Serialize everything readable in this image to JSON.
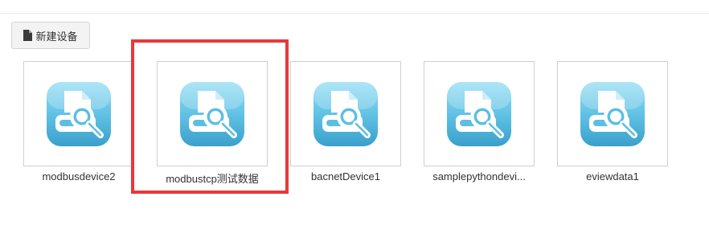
{
  "toolbar": {
    "new_device_label": "新建设备",
    "new_device_icon": "file-icon"
  },
  "devices": [
    {
      "name": "modbusdevice2",
      "icon": "device-search-icon"
    },
    {
      "name": "modbustcp测试数据",
      "icon": "device-search-icon"
    },
    {
      "name": "bacnetDevice1",
      "icon": "device-search-icon"
    },
    {
      "name": "samplepythondevi...",
      "icon": "device-search-icon"
    },
    {
      "name": "eviewdata1",
      "icon": "device-search-icon"
    }
  ],
  "highlight": {
    "target_device": "modbustcp测试数据",
    "color": "#e8383b"
  },
  "colors": {
    "icon_gradient_top": "#8fdcf3",
    "icon_gradient_bottom": "#3ba3cf",
    "button_background": "#f3f3f3"
  }
}
